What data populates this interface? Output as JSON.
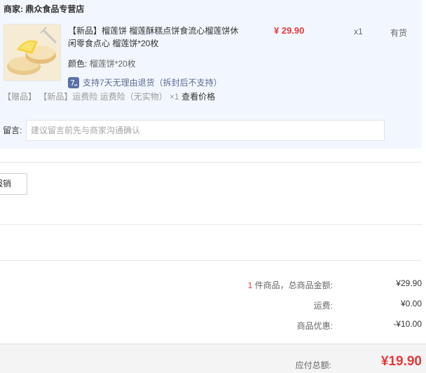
{
  "merchant": {
    "label": "商家:",
    "name": "鼎众食品专营店"
  },
  "product": {
    "title": "【新品】榴莲饼 榴莲酥糕点饼食流心榴莲饼休闲零食点心 榴莲饼*20枚",
    "price": "¥ 29.90",
    "quantity": "x1",
    "stock": "有货",
    "color_label": "颜色:",
    "color_value": "榴莲饼*20枚",
    "return_policy": "支持7天无理由退货（拆封后不支持）",
    "icon": "return-policy-icon",
    "icon_color": "#5b6fa8"
  },
  "gift": {
    "tag1": "【赠品】",
    "tag2": "【新品】运费险 运费险（无实物）",
    "quantity": "×1",
    "check_price": "查看价格"
  },
  "message": {
    "label": "留言:",
    "placeholder": "建议留言前先与商家沟通确认",
    "value": ""
  },
  "reimburse_button": "报销",
  "summary": {
    "count": "1",
    "count_suffix": " 件商品，总商品金额:",
    "goods_total": "¥29.90",
    "shipping_label": "运费:",
    "shipping_value": "¥0.00",
    "discount_label": "商品优惠:",
    "discount_value": "-¥10.00"
  },
  "total": {
    "label": "应付总额:",
    "value": "¥19.90"
  },
  "colors": {
    "accent": "#e4393c",
    "block_bg": "#f2f7ff",
    "link": "#5c6b93"
  }
}
